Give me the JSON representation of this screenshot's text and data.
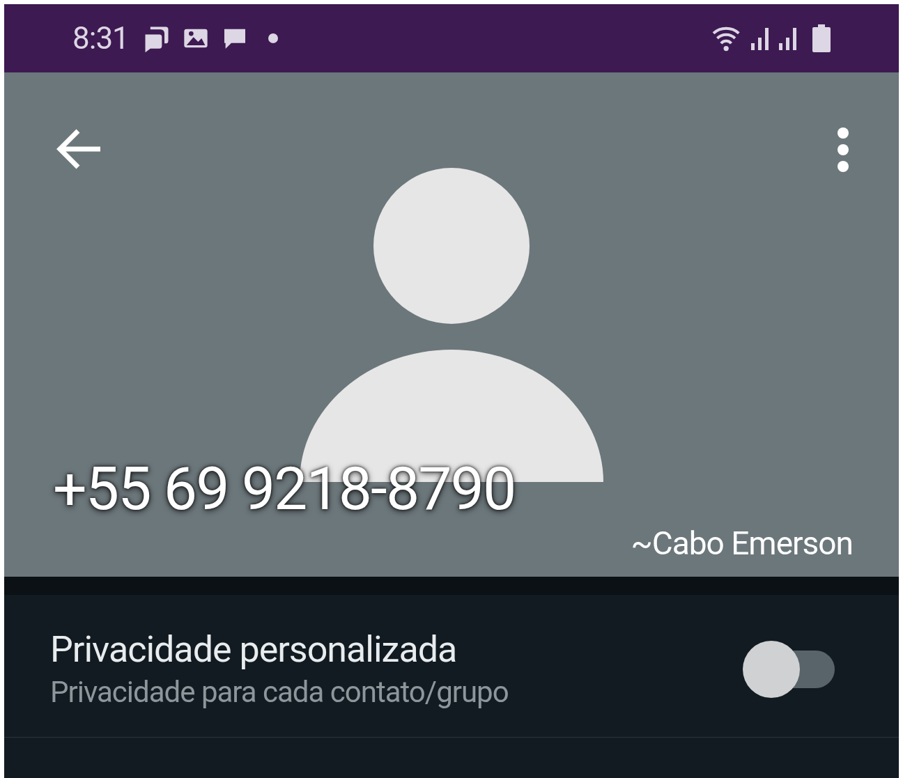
{
  "status_bar": {
    "time": "8:31"
  },
  "contact": {
    "phone": "+55 69 9218-8790",
    "name": "~Cabo Emerson"
  },
  "settings": [
    {
      "title": "Privacidade personalizada",
      "subtitle": "Privacidade para cada contato/grupo",
      "on": false
    }
  ]
}
